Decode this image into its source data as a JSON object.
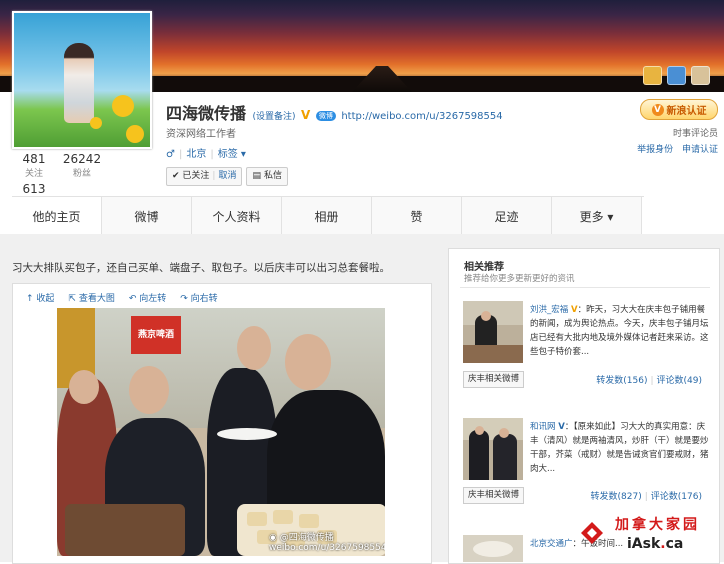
{
  "profile": {
    "name": "四海微传播",
    "set_note": "(设置备注)",
    "verified_mark": "V",
    "url_tag": "微博",
    "url": "http://weibo.com/u/3267598554",
    "job": "资深网络工作者",
    "gender_icon": "♂",
    "location": "北京",
    "tags": "标签 ▾",
    "follow_btn_prefix": "✔ 已关注",
    "follow_cancel": "取消",
    "message_btn": "私信",
    "stats": [
      {
        "value": "481",
        "label": "关注"
      },
      {
        "value": "26242",
        "label": "粉丝"
      },
      {
        "value": "613",
        "label": ""
      }
    ],
    "verify_badge": "新浪认证",
    "verify_role": "时事评论员",
    "report_link": "举报身份",
    "apply_link": "申请认证"
  },
  "nav": {
    "tabs": [
      "他的主页",
      "微博",
      "个人资料",
      "相册",
      "赞",
      "足迹",
      "更多 ▾"
    ]
  },
  "post": {
    "text": "习大大排队买包子，还自己买单、端盘子、取包子。以后庆丰可以出习总套餐啦。",
    "actions": [
      "收起",
      "查看大图",
      "向左转",
      "向右转"
    ],
    "watermark_name": "@四海微传播",
    "watermark_url": "weibo.com/u/3267598554",
    "sign_text": "燕京啤酒"
  },
  "side": {
    "title": "相关推荐",
    "subtitle": "推荐给你更多更新更好的资讯",
    "cards": [
      {
        "author": "刘洪_宏福",
        "text": "：昨天，习大大在庆丰包子铺用餐的新闻，成为舆论热点。今天，庆丰包子铺月坛店已经有大批内地及境外媒体记者赶来采访。这些包子特价套...",
        "button": "庆丰相关微博",
        "reposts": "转发数(156)",
        "comments": "评论数(49)"
      },
      {
        "author": "和讯网",
        "text": "：【原来如此】习大大的真实用意：庆丰（清风）就是两袖清风，炒肝（干）就是要炒干部，芥菜（戒财）就是告诫贪官们要戒财，猪肉大...",
        "button": "庆丰相关微博",
        "reposts": "转发数(827)",
        "comments": "评论数(176)"
      },
      {
        "author": "北京交通广",
        "text": "：午饭时间...",
        "button": "",
        "reposts": "",
        "comments": ""
      }
    ]
  },
  "watermark_site": {
    "cn": "加拿大家园",
    "en_main": "iAsk",
    "en_dot": ".",
    "en_tld": "ca"
  },
  "colors": {
    "link": "#2a6aa8",
    "verify_orange": "#f08a1c"
  }
}
